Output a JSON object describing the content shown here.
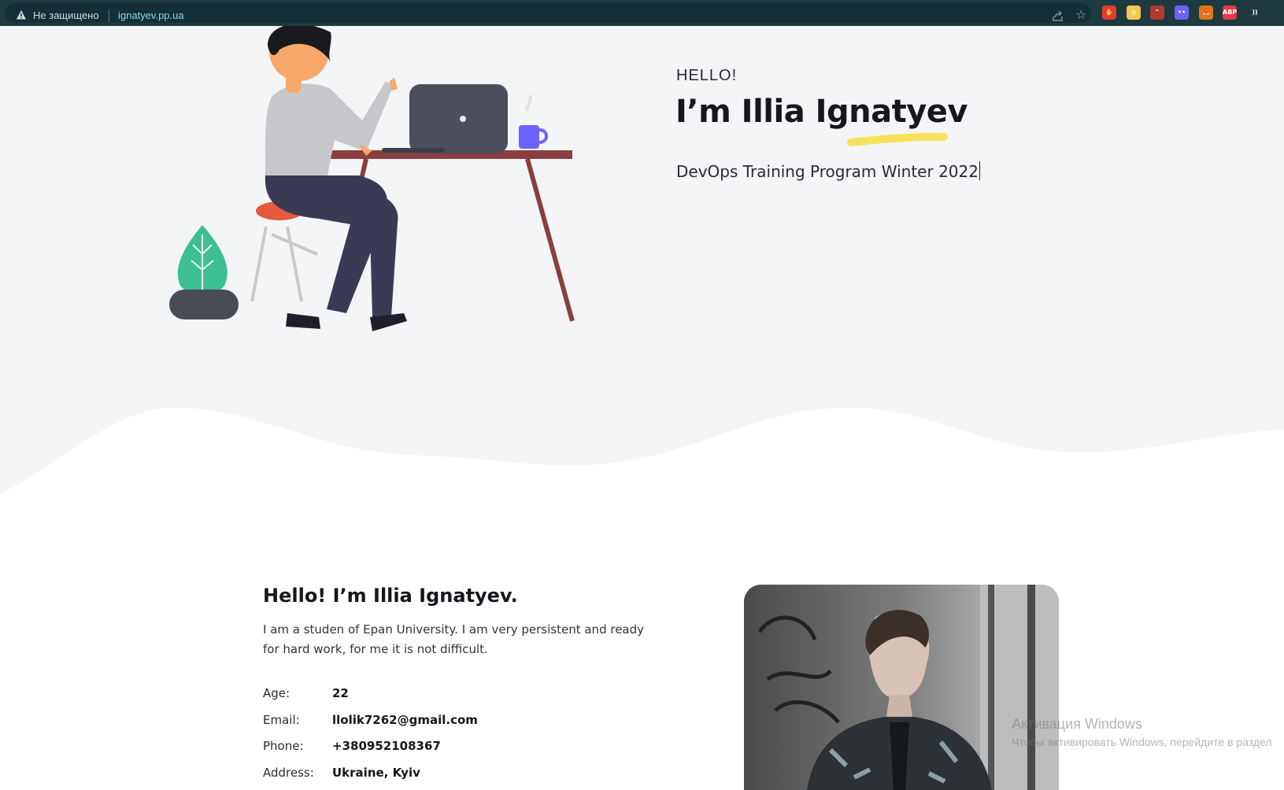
{
  "browser": {
    "security_label": "Не защищено",
    "url": "ignatyev.pp.ua",
    "extensions": [
      {
        "name": "hand-extension-icon",
        "color": "#e53935",
        "text": "✋"
      },
      {
        "name": "coin-extension-icon",
        "color": "#f2c94c",
        "text": "◎"
      },
      {
        "name": "vpn-extension-icon",
        "color": "#b23a2f",
        "text": "⌃"
      },
      {
        "name": "chat-extension-icon",
        "color": "#6c63ff",
        "text": "••"
      },
      {
        "name": "metamask-extension-icon",
        "color": "#e2761b",
        "text": "🦊"
      },
      {
        "name": "adblock-extension-icon",
        "color": "#e53946",
        "text": "ABP"
      },
      {
        "name": "wifi-extension-icon",
        "color": "#1d3b3f",
        "text": "))"
      }
    ]
  },
  "hero": {
    "greeting": "HELLO!",
    "name": "I’m Illia Ignatyev",
    "subtitle": "DevOps Training Program Winter 2022",
    "accent_color": "#f7e35b"
  },
  "about": {
    "title": "Hello! I’m Illia Ignatyev.",
    "description": "I am a studen of Epan University. I am very persistent and ready for hard work, for me it is not difficult.",
    "details": [
      {
        "label": "Age:",
        "value": "22"
      },
      {
        "label": "Email:",
        "value": "llolik7262@gmail.com"
      },
      {
        "label": "Phone:",
        "value": "+380952108367"
      },
      {
        "label": "Address:",
        "value": "Ukraine, Kyiv"
      }
    ]
  },
  "watermark": {
    "line1": "Активация Windows",
    "line2": "Чтобы активировать Windows, перейдите в раздел"
  }
}
